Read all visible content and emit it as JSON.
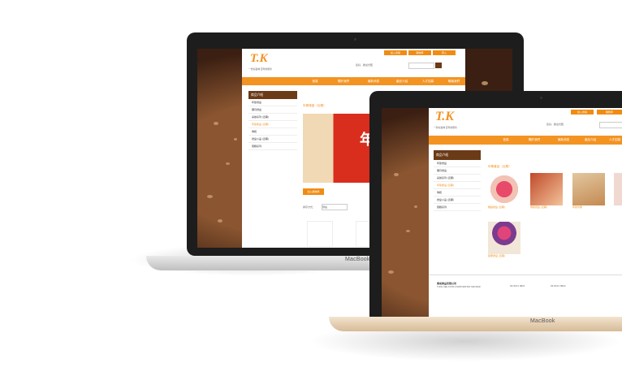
{
  "devices": {
    "back_label": "MacBook",
    "front_label": "MacBook"
  },
  "site": {
    "logo_text": "T.K",
    "tagline": "一份好滋味 百年的堅持",
    "top_buttons": [
      "加入會員",
      "購物車",
      "登入"
    ],
    "search_placeholder": "搜尋",
    "search_hint": "您好，歡迎光臨",
    "nav": [
      "首頁",
      "關於我們",
      "最新消息",
      "產品介紹",
      "人才招募",
      "聯絡我們"
    ],
    "sidebar_title": "商品介紹",
    "sidebar_items": [
      "年節禮盒",
      "彌月禮盒",
      "喜餅系列 (近期)",
      "年節產品 (近期)",
      "傳統",
      "禮盒小品 (近期)",
      "蛋糕系列"
    ],
    "content_title_back": "年節禮盒（近期）",
    "content_title_front": "年節產品（近期）",
    "product_names_front": [
      "糕點禮盒 (近期)",
      "傳統禮盒 (近期)",
      "年節米果",
      "糖果禮盒",
      "節慶禮盒 (近期)"
    ],
    "sort_label": "排序方式：",
    "sort_value": "預設",
    "banner_text": "年",
    "add_to_cart": "加入購物車",
    "footer_company": "東成食品有限公司",
    "footer_address": "TUNG KEE FOOD CORPORATION SDN BHD",
    "footer_phone": "03-5161 0821",
    "footer_fax": "03-5161 0822"
  }
}
